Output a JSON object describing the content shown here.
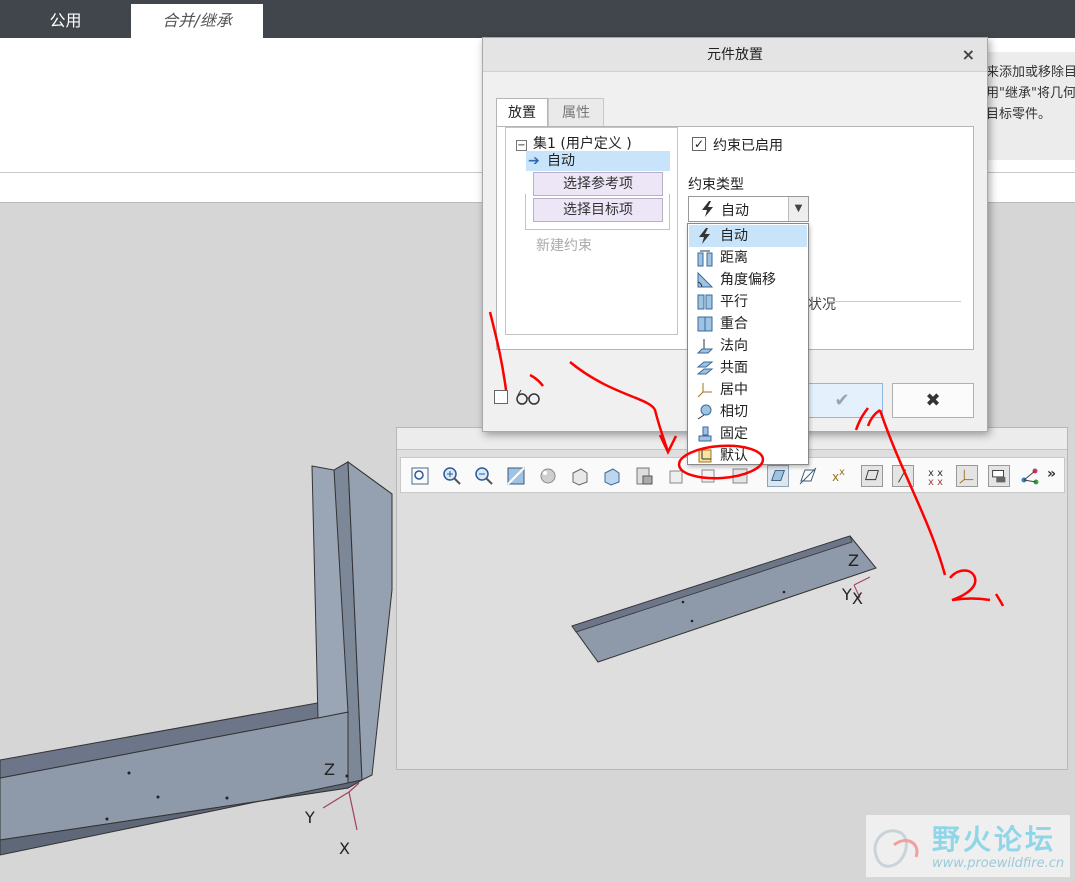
{
  "ribbon": {
    "tabs": [
      {
        "label": "公用"
      },
      {
        "label": "合并/继承"
      }
    ],
    "tooltip_lines": [
      "来添加或移除目",
      "用\"继承\"将几何",
      "目标零件。"
    ]
  },
  "dialog": {
    "title": "元件放置",
    "close_label": "×",
    "tabs": [
      {
        "label": "放置"
      },
      {
        "label": "属性"
      }
    ],
    "tree": {
      "set_label": "集1 (用户定义 )",
      "auto_label": "自动",
      "select_ref_label": "选择参考项",
      "select_target_label": "选择目标项",
      "new_constraint_label": "新建约束"
    },
    "constraint_enabled": {
      "label": "约束已启用",
      "checked": true
    },
    "constraint_type_label": "约束类型",
    "constraint_type_value": "自动",
    "status_partial_label": "状况",
    "buttons": {
      "ok": "✔",
      "cancel": "✖"
    },
    "bottom_checkbox_checked": false
  },
  "dropdown": {
    "items": [
      {
        "label": "自动",
        "icon": "lightning-icon",
        "selected": true
      },
      {
        "label": "距离",
        "icon": "distance-icon",
        "selected": false
      },
      {
        "label": "角度偏移",
        "icon": "angle-offset-icon",
        "selected": false
      },
      {
        "label": "平行",
        "icon": "parallel-icon",
        "selected": false
      },
      {
        "label": "重合",
        "icon": "coincident-icon",
        "selected": false
      },
      {
        "label": "法向",
        "icon": "normal-icon",
        "selected": false
      },
      {
        "label": "共面",
        "icon": "coplanar-icon",
        "selected": false
      },
      {
        "label": "居中",
        "icon": "centered-icon",
        "selected": false
      },
      {
        "label": "相切",
        "icon": "tangent-icon",
        "selected": false
      },
      {
        "label": "固定",
        "icon": "fixed-icon",
        "selected": false
      },
      {
        "label": "默认",
        "icon": "default-icon",
        "selected": false
      }
    ]
  },
  "preview": {
    "toolbar_icons": [
      "refit-icon",
      "zoom-in-icon",
      "zoom-out-icon",
      "repaint-icon",
      "shading-icon",
      "display-style-icon",
      "saved-views-icon",
      "view-manager-icon",
      "perspective-icon",
      "plane-display-icon",
      "axis-display-icon",
      "point-display-icon",
      "csys-display-icon",
      "annotation-display-icon",
      "spin-center-icon",
      "more-icon"
    ],
    "more_label": "»",
    "axis_labels": {
      "z": "Z",
      "y": "Y",
      "x": "X"
    }
  },
  "main_axes": {
    "z": "Z",
    "y": "Y",
    "x": "X"
  },
  "annotations": {
    "one": "1、",
    "two": "2、"
  },
  "watermark": {
    "title": "野火论坛",
    "url": "www.proewildfire.cn"
  },
  "colors": {
    "topbar": "#40464c",
    "part": "#8e99aa",
    "selection": "#c8e4fa",
    "annotation": "#ff0000"
  }
}
